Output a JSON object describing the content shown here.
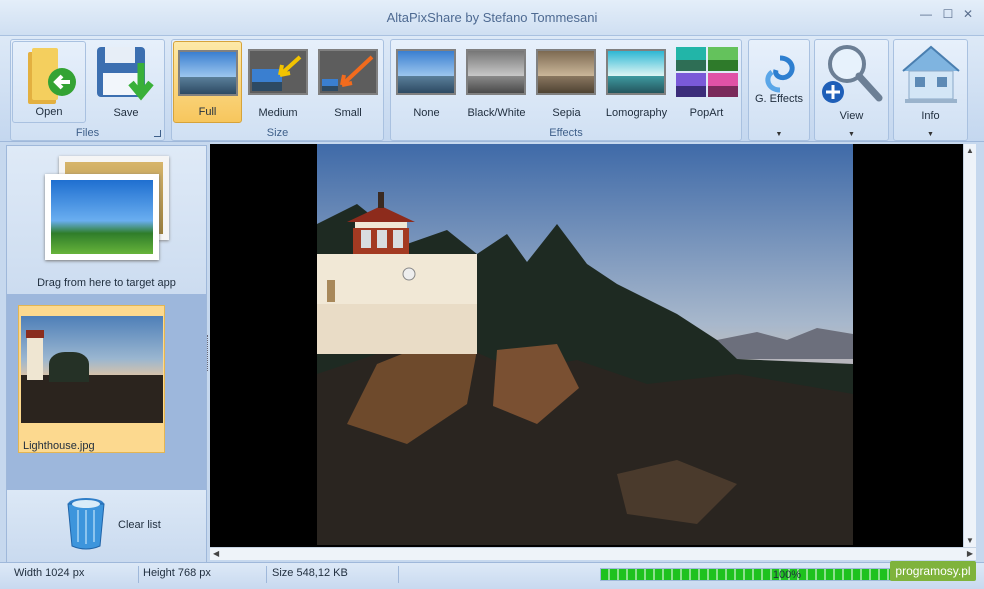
{
  "window": {
    "title": "AltaPixShare by Stefano Tommesani",
    "controls": {
      "minimize": "—",
      "maximize": "☐",
      "close": "✕"
    }
  },
  "ribbon": {
    "files": {
      "label": "Files",
      "open_label": "Open",
      "save_label": "Save"
    },
    "size": {
      "label": "Size",
      "options": [
        {
          "label": "Full",
          "active": true
        },
        {
          "label": "Medium",
          "active": false
        },
        {
          "label": "Small",
          "active": false
        }
      ]
    },
    "effects": {
      "label": "Effects",
      "options": [
        "None",
        "Black/White",
        "Sepia",
        "Lomography",
        "PopArt"
      ]
    },
    "g_effects_label": "G. Effects",
    "view_label": "View",
    "info_label": "Info"
  },
  "left_panel": {
    "drag_label": "Drag from here to target app",
    "items": [
      {
        "filename": "Lighthouse.jpg",
        "selected": true
      }
    ],
    "clear_label": "Clear list"
  },
  "status": {
    "width": "Width 1024 px",
    "height": "Height 768 px",
    "size": "Size 548,12 KB",
    "progress_value": 1.0,
    "progress_text": "100%"
  },
  "watermark": "programosy.pl",
  "colors": {
    "accent": "#f7c65d",
    "ribbon_bg": "#d0e0f3",
    "progress_green": "#1ec21e",
    "list_selection": "#fcd98f"
  }
}
